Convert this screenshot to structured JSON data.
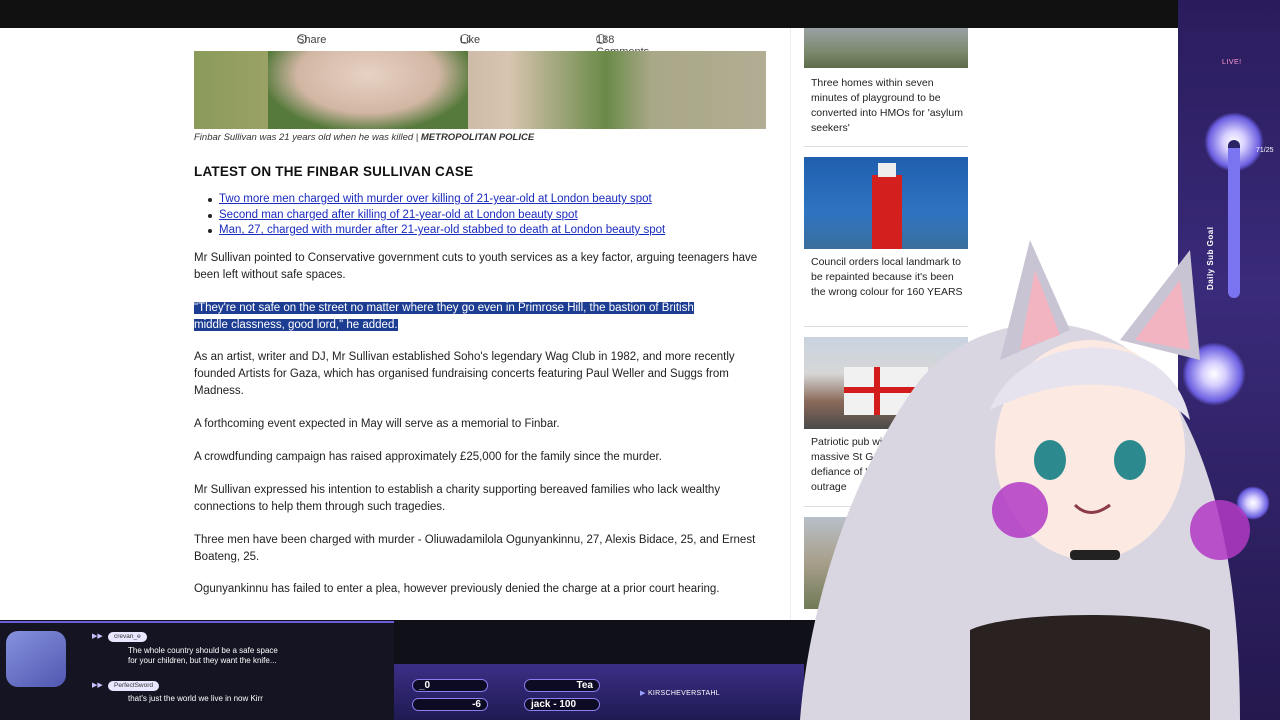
{
  "article": {
    "actions": {
      "share": "Share",
      "like": "Like",
      "comments": "188 Comments"
    },
    "caption_text": "Finbar Sullivan was 21 years old when he was killed | ",
    "caption_credit": "METROPOLITAN POLICE",
    "latest_heading": "LATEST ON THE FINBAR SULLIVAN CASE",
    "latest_links": [
      "Two more men charged with murder over killing of 21-year-old at London beauty spot",
      "Second man charged after killing of 21-year-old at London beauty spot",
      "Man, 27, charged with murder after 21-year-old stabbed to death at London beauty spot"
    ],
    "paragraphs": {
      "p1": "Mr Sullivan pointed to Conservative government cuts to youth services as a key factor, arguing teenagers have been left without safe spaces.",
      "quote_line1": "\"They're not safe on the street no matter where they go even in Primrose Hill, the bastion of British",
      "quote_line2": "middle classness, good lord,\" he added.",
      "p3": "As an artist, writer and DJ, Mr Sullivan established Soho's legendary Wag Club in 1982, and more recently founded Artists for Gaza, which has organised fundraising concerts featuring Paul Weller and Suggs from Madness.",
      "p4": "A forthcoming event expected in May will serve as a memorial to Finbar.",
      "p5": "A crowdfunding campaign has raised approximately £25,000 for the family since the murder.",
      "p6": "Mr Sullivan expressed his intention to establish a charity supporting bereaved families who lack wealthy connections to help them through such tragedies.",
      "p7": "Three men have been charged with murder - Oliuwadamilola Ogunyankinnu, 27, Alexis Bidace, 25, and Ernest Boateng, 25.",
      "p8": "Ogunyankinnu has failed to enter a plea, however previously denied the charge at a prior court hearing."
    }
  },
  "sidebar": {
    "cards": [
      {
        "title": "Three homes within seven minutes of playground to be converted into HMOs for 'asylum seekers'"
      },
      {
        "title": "Council orders local landmark to be repainted because it's been the wrong colour for 160 YEARS"
      },
      {
        "title": "Patriotic pub wins fight to keep massive St George's Cross in defiance of 'ridiculous' woke outrage"
      }
    ]
  },
  "overlay": {
    "chat": [
      {
        "user": "crevan_e",
        "message_line1": "The whole country should be a safe space",
        "message_line2": "for your children, but they want the knife..."
      },
      {
        "user": "PerfectSword",
        "message_line1": "that's just the world we live in now Kirr",
        "message_line2": ""
      }
    ],
    "ticker": {
      "item1": "_0",
      "item2": "Tea",
      "item3": "-6",
      "item4": "jack - 100"
    },
    "twitch_handle": "KIRSCHEVERSTAHL",
    "live_label": "LIVE!",
    "goal_label": "Daily Sub Goal",
    "goal_count": "71/25",
    "goal_progress": 0.95,
    "colors": {
      "accent": "#6b5ed8",
      "highlight": "#1c3d91",
      "link": "#1a2bbf"
    }
  }
}
